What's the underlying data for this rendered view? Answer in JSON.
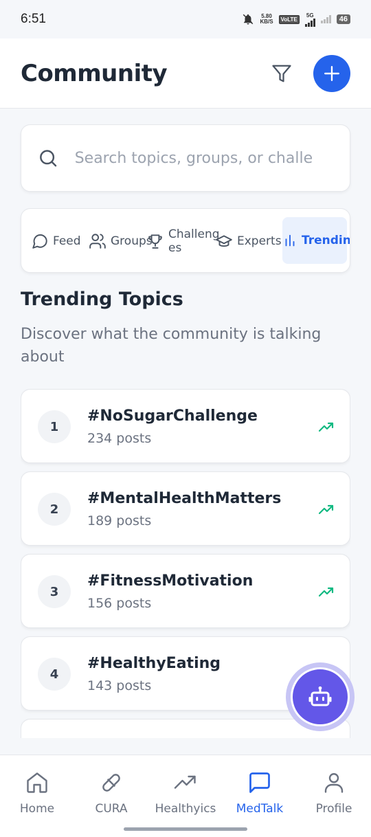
{
  "status_bar": {
    "time": "6:51",
    "speed_top": "5.80",
    "speed_bottom": "KB/S",
    "volte": "VoLTE",
    "network": "5G",
    "battery": "46"
  },
  "header": {
    "title": "Community",
    "filter_icon": "filter-icon",
    "add_icon": "plus-icon"
  },
  "search": {
    "placeholder": "Search topics, groups, or challe",
    "icon": "search-icon"
  },
  "tabs": [
    {
      "label": "Feed",
      "icon": "chat-bubble-icon"
    },
    {
      "label": "Groups",
      "icon": "users-icon"
    },
    {
      "label": "Challenges",
      "icon": "trophy-icon"
    },
    {
      "label": "Experts",
      "icon": "graduation-cap-icon"
    },
    {
      "label": "Trending",
      "icon": "bar-chart-icon",
      "active": true
    }
  ],
  "section": {
    "title": "Trending Topics",
    "subtitle": "Discover what the community is talking about"
  },
  "topics": [
    {
      "rank": "1",
      "tag": "#NoSugarChallenge",
      "posts": "234 posts"
    },
    {
      "rank": "2",
      "tag": "#MentalHealthMatters",
      "posts": "189 posts"
    },
    {
      "rank": "3",
      "tag": "#FitnessMotivation",
      "posts": "156 posts"
    },
    {
      "rank": "4",
      "tag": "#HealthyEating",
      "posts": "143 posts"
    }
  ],
  "fab": {
    "icon": "robot-icon"
  },
  "bottom_nav": [
    {
      "label": "Home",
      "icon": "home-icon"
    },
    {
      "label": "CURA",
      "icon": "pill-icon"
    },
    {
      "label": "Healthyics",
      "icon": "trending-up-icon"
    },
    {
      "label": "MedTalk",
      "icon": "message-square-icon",
      "active": true
    },
    {
      "label": "Profile",
      "icon": "user-icon"
    }
  ],
  "colors": {
    "accent": "#2563eb",
    "trend": "#10b981",
    "fab": "#6357e8"
  }
}
